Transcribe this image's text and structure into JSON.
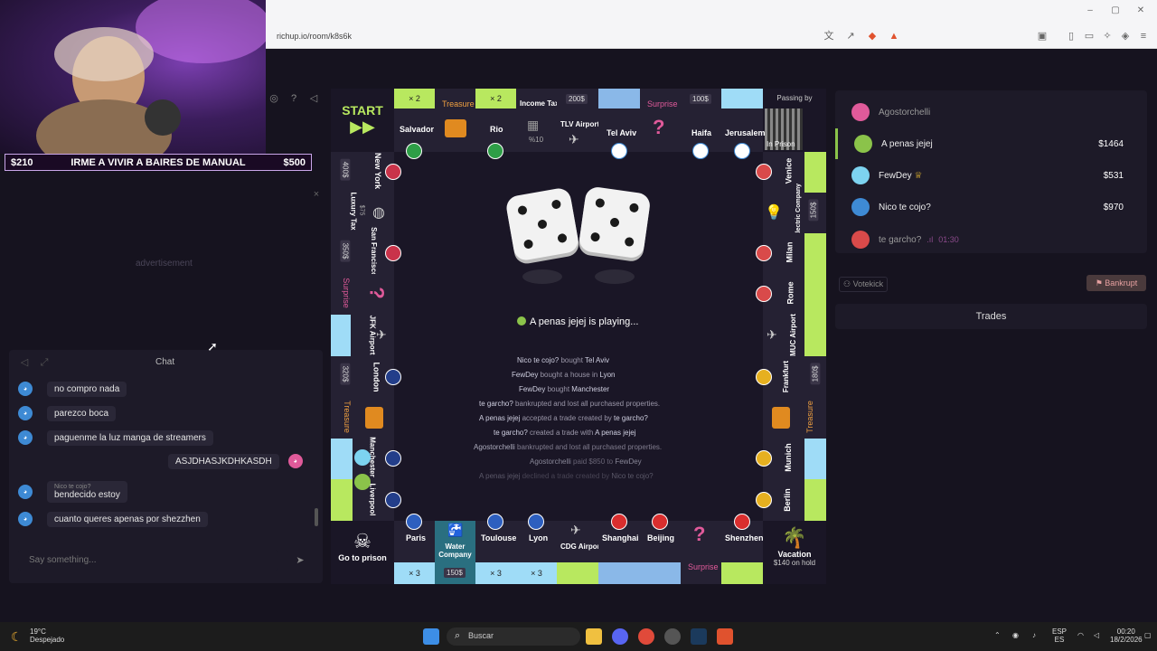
{
  "browser": {
    "url": "richup.io/room/k8s6k"
  },
  "ticker": {
    "left": "$210",
    "text": "IRME A VIVIR A BAIRES DE MANUAL",
    "right": "$500"
  },
  "left": {
    "ad_text": "advertisement",
    "chat_title": "Chat",
    "input_placeholder": "Say something..."
  },
  "chat": {
    "messages": [
      {
        "text": "no compro nada"
      },
      {
        "text": "parezco boca"
      },
      {
        "text": "paguenme la luz manga de streamers"
      },
      {
        "text": "ASJDHASJKDHKASDH",
        "own": true
      },
      {
        "reply_to": "Nico te cojo?",
        "text": "bendecido estoy"
      },
      {
        "text": "cuanto queres apenas por shezzhen"
      }
    ]
  },
  "board": {
    "start": "START",
    "top": [
      "Salvador",
      "Treasure",
      "Rio",
      "Income Tax",
      "TLV Airport",
      "Tel Aviv",
      "Surprise",
      "Haifa",
      "Jerusalem",
      "Passing by",
      "In Prison"
    ],
    "top_badges": {
      "salvador": "× 2",
      "rio": "× 2",
      "income_pct": "%10",
      "airport_price": "200$",
      "haifa_price": "100$"
    },
    "left": [
      "New York",
      "Luxury Tax",
      "San Francisco",
      "Surprise",
      "JFK Airport",
      "London",
      "Treasure",
      "Manchester",
      "Liverpool"
    ],
    "left_badges": {
      "ny_price": "400$",
      "lux_price": "$75",
      "sf_price": "350$",
      "london_price": "320$"
    },
    "right": [
      "Venice",
      "Electric Company",
      "Milan",
      "Rome",
      "MUC Airport",
      "Frankfurt",
      "Treasure",
      "Munich",
      "Berlin"
    ],
    "right_badges": {
      "elec_price": "150$",
      "frankfurt_price": "180$"
    },
    "bottom": [
      "Paris",
      "Water Company",
      "Toulouse",
      "Lyon",
      "CDG Airport",
      "Shanghai",
      "Beijing",
      "Surprise",
      "Shenzhen"
    ],
    "bottom_badges": {
      "paris": "× 3",
      "water_price": "150$",
      "toulouse": "× 3",
      "lyon": "× 3"
    },
    "go_to_prison": "Go to prison",
    "vacation": "Vacation",
    "vacation_pot": "$140 on hold",
    "playing": "A penas jejej  is playing...",
    "log": [
      {
        "who": "Nico te cojo?",
        "action": "bought",
        "target": "Tel Aviv"
      },
      {
        "who": "FewDey",
        "action": "bought a house in",
        "target": "Lyon"
      },
      {
        "who": "FewDey",
        "action": "bought",
        "target": "Manchester"
      },
      {
        "who": "te garcho?",
        "action": "bankrupted and lost all purchased properties.",
        "target": ""
      },
      {
        "who": "A penas jejej",
        "action": "accepted a trade created by",
        "target": "te garcho?"
      },
      {
        "who": "te garcho?",
        "action": "created a trade with",
        "target": "A penas jejej"
      },
      {
        "who": "Agostorchelli",
        "action": "bankrupted and lost all purchased properties.",
        "target": ""
      },
      {
        "who": "Agostorchelli",
        "action": "paid $850 to",
        "target": "FewDey"
      },
      {
        "who": "A penas jejej",
        "action": "declined a trade created by",
        "target": "Nico te cojo?"
      }
    ]
  },
  "players": [
    {
      "name": "Agostorchelli",
      "money": "",
      "color": "#e05a9a",
      "faded": true
    },
    {
      "name": "A penas jejej",
      "money": "$1464",
      "color": "#8bc34a",
      "active": true
    },
    {
      "name": "FewDey",
      "money": "$531",
      "color": "#7dd3f0",
      "crown": "♕"
    },
    {
      "name": "Nico te cojo?",
      "money": "$970",
      "color": "#3e8ad4"
    },
    {
      "name": "te garcho?",
      "money": "01:30",
      "color": "#d94a4a",
      "faded": true
    }
  ],
  "controls": {
    "votekick": "Votekick",
    "bankrupt": "Bankrupt",
    "trades": "Trades"
  },
  "taskbar": {
    "weather_temp": "19°C",
    "weather_desc": "Despejado",
    "search": "Buscar",
    "lang1": "ESP",
    "lang2": "ES",
    "time": "00:20",
    "date": "18/2/2026"
  }
}
